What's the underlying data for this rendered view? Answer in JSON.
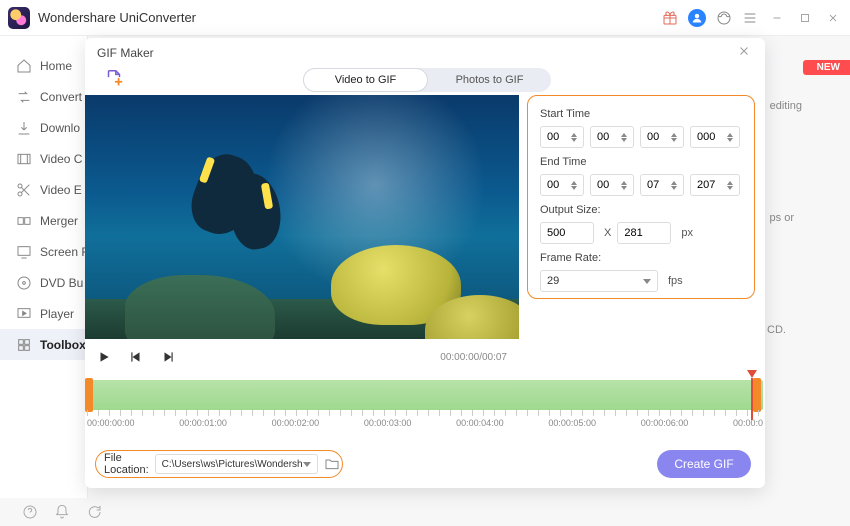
{
  "app": {
    "title": "Wondershare UniConverter"
  },
  "badge_new": "NEW",
  "sidebar": {
    "items": [
      {
        "label": "Home"
      },
      {
        "label": "Convert"
      },
      {
        "label": "Downlo"
      },
      {
        "label": "Video C"
      },
      {
        "label": "Video E"
      },
      {
        "label": "Merger"
      },
      {
        "label": "Screen F"
      },
      {
        "label": "DVD Bu"
      },
      {
        "label": "Player"
      },
      {
        "label": "Toolbox"
      }
    ]
  },
  "snippets": {
    "s1": "editing",
    "s2": "ps or",
    "s3": "CD."
  },
  "modal": {
    "title": "GIF Maker",
    "tabs": {
      "video": "Video to GIF",
      "photos": "Photos to GIF"
    },
    "time_readout": "00:00:00/00:07",
    "settings": {
      "start_label": "Start Time",
      "start": {
        "h": "00",
        "m": "00",
        "s": "00",
        "ms": "000"
      },
      "end_label": "End Time",
      "end": {
        "h": "00",
        "m": "00",
        "s": "07",
        "ms": "207"
      },
      "size_label": "Output Size:",
      "size": {
        "w": "500",
        "h": "281",
        "sep": "X",
        "unit": "px"
      },
      "fps_label": "Frame Rate:",
      "fps_value": "29",
      "fps_unit": "fps"
    },
    "timeline": {
      "labels": [
        "00:00:00:00",
        "00:00:01:00",
        "00:00:02:00",
        "00:00:03:00",
        "00:00:04:00",
        "00:00:05:00",
        "00:00:06:00",
        "00:00:0"
      ]
    },
    "file": {
      "label": "File Location:",
      "path": "C:\\Users\\ws\\Pictures\\Wondersh"
    },
    "create_label": "Create GIF"
  }
}
